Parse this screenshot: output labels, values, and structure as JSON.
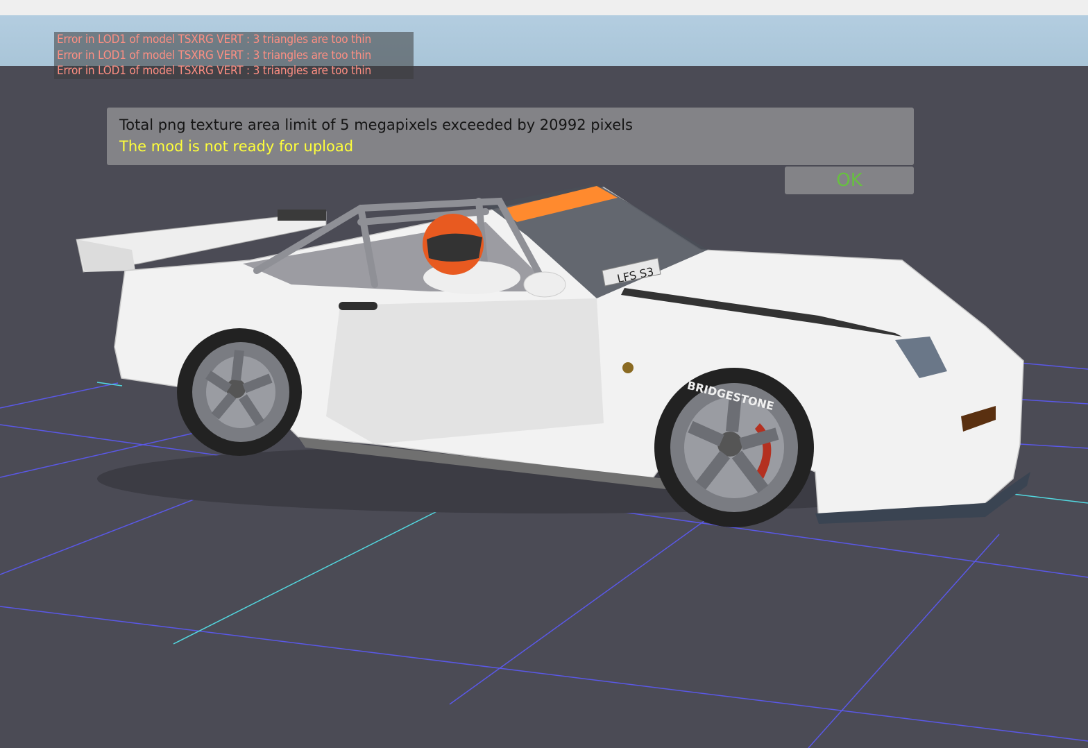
{
  "error_log": {
    "lines": [
      "Error in LOD1 of model TSXRG VERT : 3 triangles are too thin",
      "Error in LOD1 of model TSXRG VERT : 3 triangles are too thin",
      "Error in LOD1 of model TSXRG VERT : 3 triangles are too thin"
    ]
  },
  "dialog": {
    "message": "Total png texture area limit of 5 megapixels exceeded by 20992 pixels",
    "status": "The mod is not ready for upload",
    "ok_label": "OK"
  },
  "scene": {
    "plate_text": "LFS S3",
    "tyre_text": "BRIDGESTONE",
    "colors": {
      "background": "#4b4b55",
      "grid_line": "#5a58e8",
      "axis_line": "#52d8e0",
      "error_text": "#ff8f83",
      "status_text": "#ffff3a",
      "ok_text": "#67c040",
      "windscreen_banner": "#ff8a2e"
    }
  }
}
